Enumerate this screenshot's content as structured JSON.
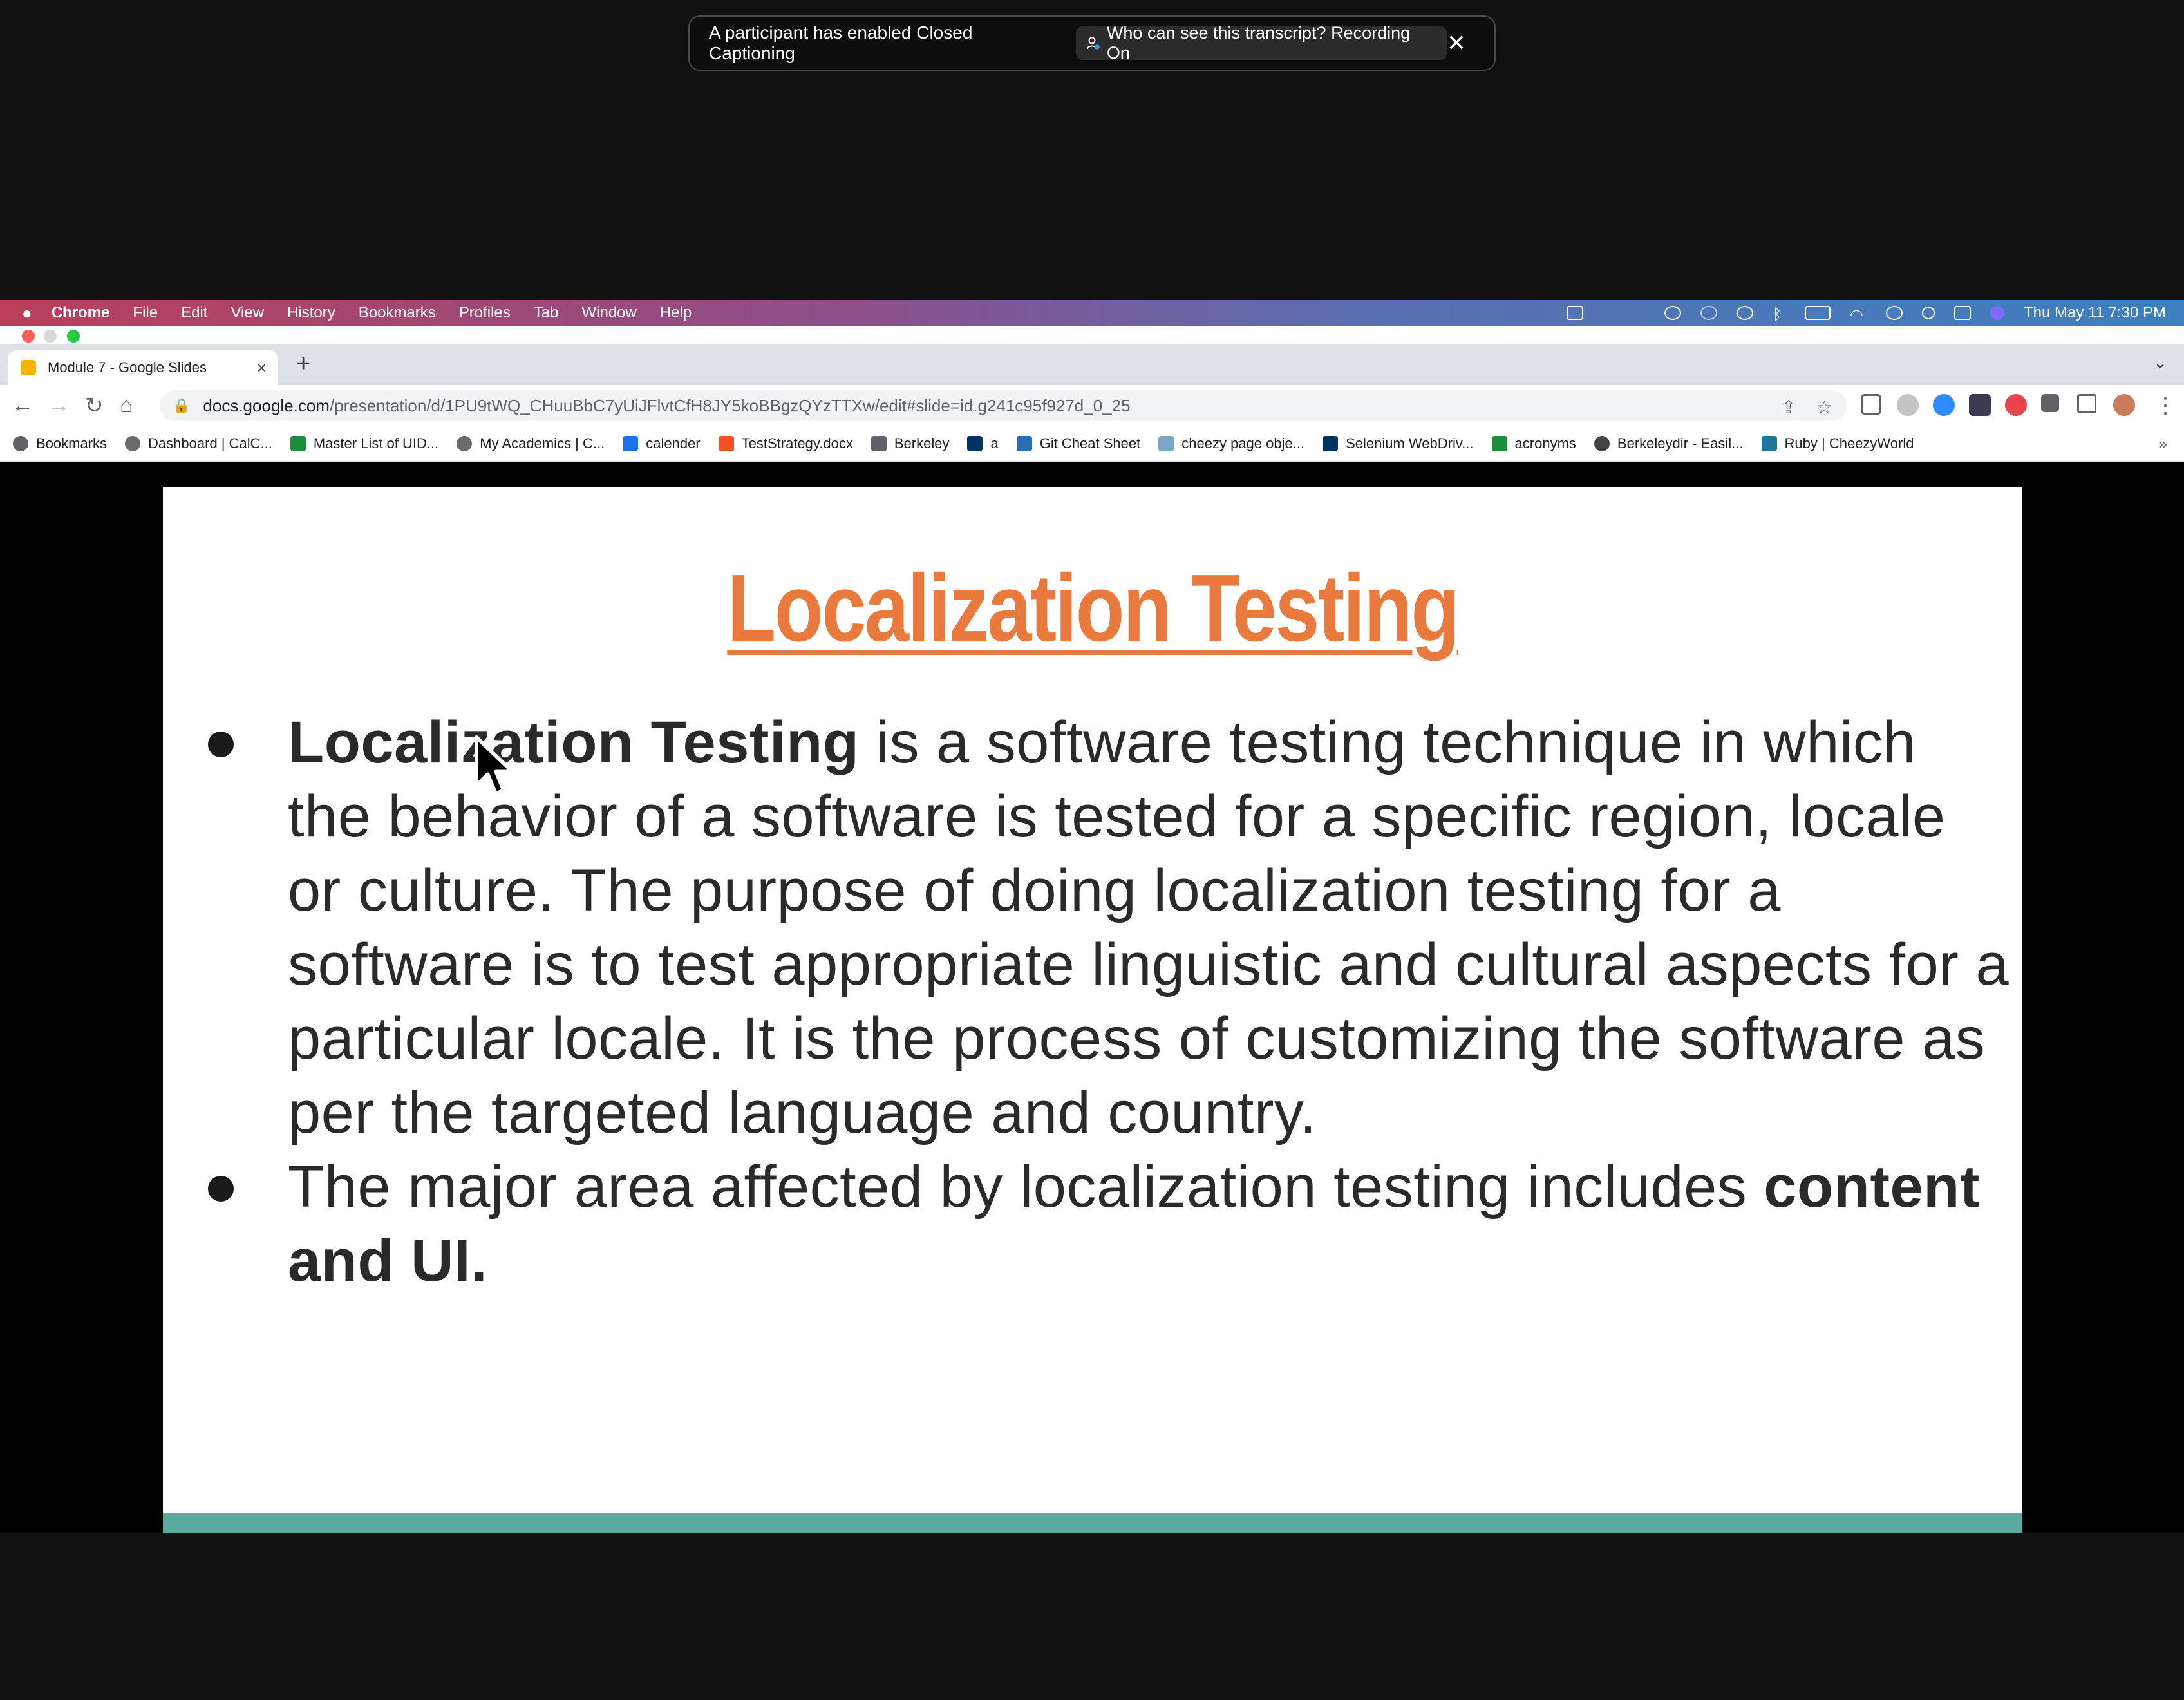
{
  "caption_banner": {
    "message": "A participant has enabled Closed Captioning",
    "transcript_button": "Who can see this transcript? Recording On"
  },
  "menubar": {
    "items": [
      "Chrome",
      "File",
      "Edit",
      "View",
      "History",
      "Bookmarks",
      "Profiles",
      "Tab",
      "Window",
      "Help"
    ],
    "clock": "Thu May 11  7:30 PM"
  },
  "browser": {
    "tab_title": "Module 7 - Google Slides",
    "url_host": "docs.google.com",
    "url_path": "/presentation/d/1PU9tWQ_CHuuBbC7yUiJFlvtCfH8JY5koBBgzQYzTTXw/edit#slide=id.g241c95f927d_0_25",
    "bookmarks": [
      {
        "label": "Bookmarks",
        "icon": "star-icon",
        "color": "#5f6368"
      },
      {
        "label": "Dashboard | CalC...",
        "icon": "c-icon",
        "color": "#6b6b6b"
      },
      {
        "label": "Master List of UID...",
        "icon": "sheets-icon",
        "color": "#1e8e3e"
      },
      {
        "label": "My Academics | C...",
        "icon": "c-icon",
        "color": "#6b6b6b"
      },
      {
        "label": "calender",
        "icon": "s-icon",
        "color": "#1a73e8"
      },
      {
        "label": "TestStrategy.docx",
        "icon": "ms-icon",
        "color": "#f25022"
      },
      {
        "label": "Berkeley",
        "icon": "folder-icon",
        "color": "#5f6368"
      },
      {
        "label": "a",
        "icon": "cal-icon",
        "color": "#003262"
      },
      {
        "label": "Git Cheat Sheet",
        "icon": "git-icon",
        "color": "#2e6db4"
      },
      {
        "label": "cheezy page obje...",
        "icon": "cheezy-icon",
        "color": "#7aa7c7"
      },
      {
        "label": "Selenium WebDriv...",
        "icon": "cal-icon",
        "color": "#003262"
      },
      {
        "label": "acronyms",
        "icon": "sheets-icon",
        "color": "#1e8e3e"
      },
      {
        "label": "Berkeleydir - Easil...",
        "icon": "globe-icon",
        "color": "#444444"
      },
      {
        "label": "Ruby | CheezyWorld",
        "icon": "wordpress-icon",
        "color": "#21759b"
      }
    ]
  },
  "slide": {
    "title": "Localization Testing",
    "bullet1_bold": "Localization Testing",
    "bullet1_text": " is a software testing technique in which the behavior of a software is tested for a specific region, locale or culture. The purpose of doing localization testing for a software is to test appropriate linguistic and cultural aspects for a particular locale. It is the process of customizing the software as per the targeted language and country.",
    "bullet2_text": "The major area affected by localization testing includes ",
    "bullet2_bold": "content and UI.",
    "title_color": "#e87a3e",
    "bar_color": "#5ba89e"
  }
}
